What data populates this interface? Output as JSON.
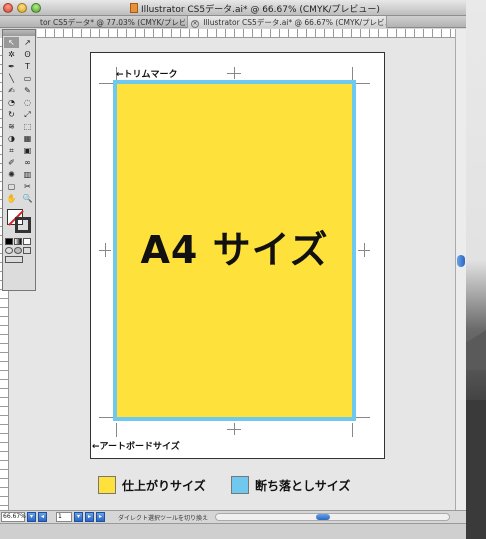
{
  "window": {
    "title": "Illustrator CS5データ.ai* @ 66.67% (CMYK/プレビュー)",
    "tabs": [
      {
        "label": "tor CS5データ* @ 77.03% (CMYK/プレビュー)"
      },
      {
        "label": "Illustrator CS5データ.ai* @ 66.67% (CMYK/プレビュー)"
      }
    ]
  },
  "artboard": {
    "main_text": "A4 サイズ",
    "trim_note": "←トリムマーク",
    "artboard_note": "←アートボードサイズ"
  },
  "legend": [
    {
      "label": "仕上がりサイズ",
      "color": "#fee13a"
    },
    {
      "label": "断ち落としサイズ",
      "color": "#6fc8ee"
    }
  ],
  "status": {
    "zoom": "66.67%",
    "page": "1",
    "tool_hint": "ダイレクト選択ツールを切り換え"
  },
  "tools": [
    "selection-tool",
    "direct-selection-tool",
    "magic-wand-tool",
    "lasso-tool",
    "pen-tool",
    "type-tool",
    "line-tool",
    "rectangle-tool",
    "paintbrush-tool",
    "pencil-tool",
    "blob-brush-tool",
    "eraser-tool",
    "rotate-tool",
    "scale-tool",
    "width-tool",
    "free-transform-tool",
    "shape-builder-tool",
    "perspective-grid-tool",
    "mesh-tool",
    "gradient-tool",
    "eyedropper-tool",
    "blend-tool",
    "symbol-sprayer-tool",
    "column-graph-tool",
    "artboard-tool",
    "slice-tool",
    "hand-tool",
    "zoom-tool"
  ],
  "tool_glyphs": [
    "↖",
    "↗",
    "✲",
    "ʘ",
    "✒",
    "T",
    "╲",
    "▭",
    "✍",
    "✎",
    "◔",
    "◌",
    "↻",
    "⤢",
    "≋",
    "⬚",
    "◑",
    "▦",
    "⌗",
    "▣",
    "✐",
    "∞",
    "✺",
    "▥",
    "▢",
    "✂",
    "✋",
    "🔍"
  ]
}
